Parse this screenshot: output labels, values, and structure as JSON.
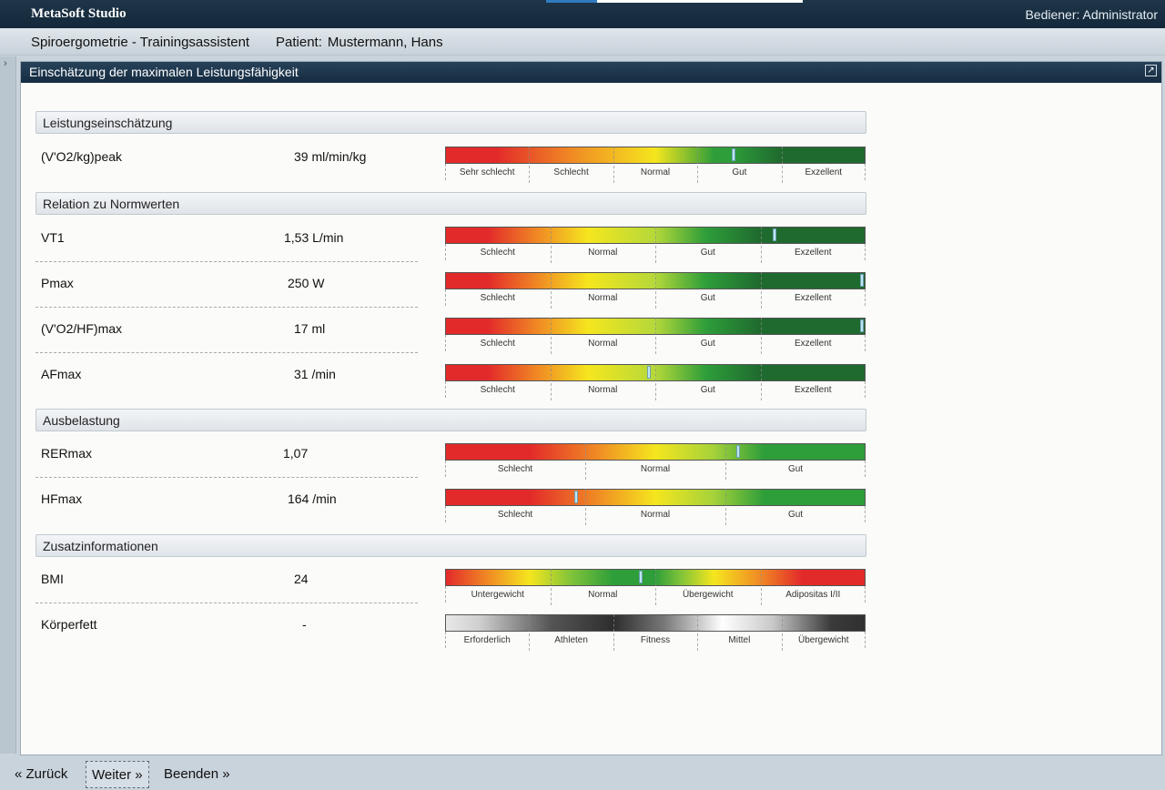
{
  "app": {
    "title": "MetaSoft Studio",
    "user": "Bediener: Administrator"
  },
  "context": {
    "module": "Spiroergometrie - Trainingsassistent",
    "patient_label": "Patient:",
    "patient_name": "Mustermann, Hans"
  },
  "panel": {
    "title": "Einschätzung der maximalen Leistungsfähigkeit"
  },
  "sections": {
    "s1": "Leistungseinschätzung",
    "s2": "Relation zu Normwerten",
    "s3": "Ausbelastung",
    "s4": "Zusatzinformationen"
  },
  "rows": [
    {
      "label": "(V'O2/kg)peak",
      "value": "39 ml/min/kg",
      "marker": 0.687,
      "scale": "five",
      "segments": [
        "Sehr schlecht",
        "Schlecht",
        "Normal",
        "Gut",
        "Exzellent"
      ]
    },
    {
      "label": "VT1",
      "value": "1,53 L/min",
      "marker": 0.783,
      "scale": "four",
      "segments": [
        "Schlecht",
        "Normal",
        "Gut",
        "Exzellent"
      ]
    },
    {
      "label": "Pmax",
      "value": "250 W",
      "marker": 0.997,
      "scale": "four",
      "segments": [
        "Schlecht",
        "Normal",
        "Gut",
        "Exzellent"
      ]
    },
    {
      "label": "(V'O2/HF)max",
      "value": "17 ml",
      "marker": 0.997,
      "scale": "four",
      "segments": [
        "Schlecht",
        "Normal",
        "Gut",
        "Exzellent"
      ]
    },
    {
      "label": "AFmax",
      "value": "31 /min",
      "marker": 0.485,
      "scale": "four",
      "segments": [
        "Schlecht",
        "Normal",
        "Gut",
        "Exzellent"
      ]
    },
    {
      "label": "RERmax",
      "value": "1,07",
      "marker": 0.697,
      "scale": "three",
      "segments": [
        "Schlecht",
        "Normal",
        "Gut"
      ]
    },
    {
      "label": "HFmax",
      "value": "164 /min",
      "marker": 0.312,
      "scale": "three",
      "segments": [
        "Schlecht",
        "Normal",
        "Gut"
      ]
    },
    {
      "label": "BMI",
      "value": "24",
      "marker": 0.465,
      "scale": "bmi",
      "segments": [
        "Untergewicht",
        "Normal",
        "Übergewicht",
        "Adipositas I/II"
      ]
    },
    {
      "label": "Körperfett",
      "value": "-",
      "marker": null,
      "scale": "fat",
      "segments": [
        "Erforderlich",
        "Athleten",
        "Fitness",
        "Mittel",
        "Übergewicht"
      ]
    }
  ],
  "footer": {
    "back": "« Zurück",
    "next": "Weiter »",
    "finish": "Beenden »"
  },
  "colors": {
    "red": "#e32a2a",
    "orange": "#f08a24",
    "yellow": "#f5e61e",
    "green": "#2e9e3a",
    "darkgreen": "#1f6a2e"
  }
}
